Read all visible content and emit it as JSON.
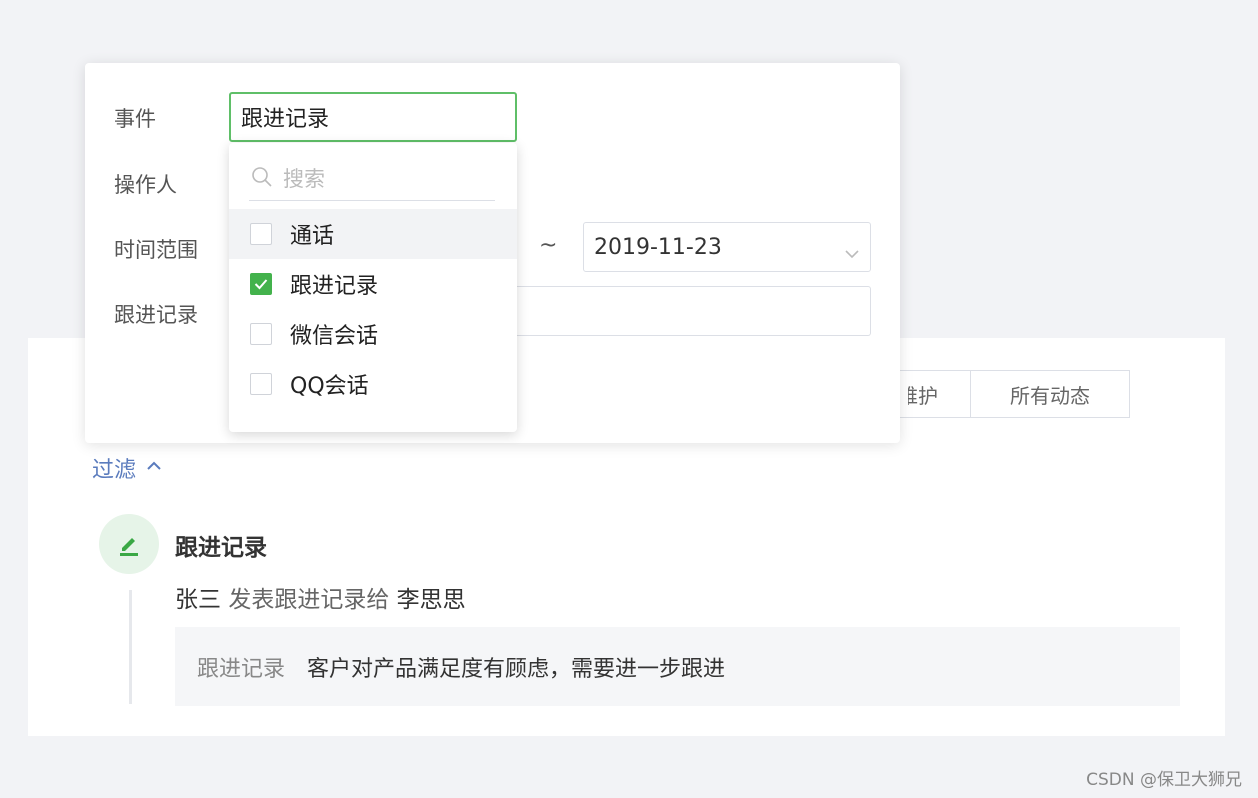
{
  "background": {
    "tabs": [
      "维护",
      "所有动态"
    ],
    "filter_toggle_label": "过滤",
    "event": {
      "title": "跟进记录",
      "actor": "张三",
      "action": "发表跟进记录给",
      "target": "李思思",
      "detail_label": "跟进记录",
      "detail_value": "客户对产品满足度有顾虑，需要进一步跟进"
    }
  },
  "filter": {
    "labels": {
      "event": "事件",
      "operator": "操作人",
      "time_range": "时间范围",
      "record": "跟进记录"
    },
    "event_select_value": "跟进记录",
    "range_separator": "~",
    "end_date": "2019-11-23"
  },
  "dropdown": {
    "search_placeholder": "搜索",
    "options": [
      {
        "label": "通话",
        "checked": false
      },
      {
        "label": "跟进记录",
        "checked": true
      },
      {
        "label": "微信会话",
        "checked": false
      },
      {
        "label": "QQ会话",
        "checked": false
      }
    ]
  },
  "colors": {
    "accent_green": "#43b24c",
    "link_blue": "#5a7bbd"
  },
  "watermark": "CSDN @保卫大狮兄"
}
